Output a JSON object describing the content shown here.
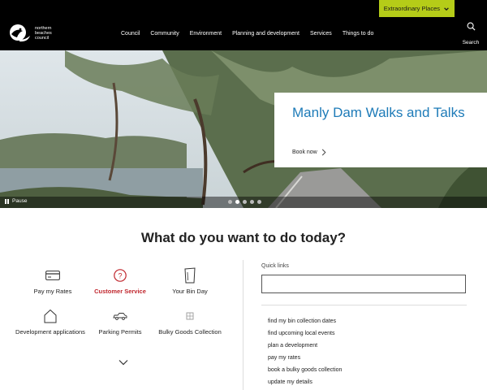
{
  "utility": {
    "extraordinary_label": "Extraordinary Places",
    "accent": "#b5cc18"
  },
  "header": {
    "logo_lines": [
      "northern",
      "beaches",
      "council"
    ],
    "nav": [
      "Council",
      "Community",
      "Environment",
      "Planning and development",
      "Services",
      "Things to do"
    ],
    "search_label": "Search"
  },
  "hero": {
    "title": "Manly Dam Walks and Talks",
    "link_label": "Book now",
    "pause_label": "Pause",
    "slides": 5,
    "active_slide": 2,
    "title_color": "#1e7bb8"
  },
  "main": {
    "question": "What do you want to do today?",
    "tasks": [
      {
        "label": "Pay my Rates",
        "icon": "credit-card-icon"
      },
      {
        "label": "Customer Service",
        "icon": "question-mark-icon",
        "color": "#c0262d"
      },
      {
        "label": "Your Bin Day",
        "icon": "bin-icon"
      },
      {
        "label": "Development applications",
        "icon": "house-icon"
      },
      {
        "label": "Parking Permits",
        "icon": "car-icon"
      },
      {
        "label": "Bulky Goods Collection",
        "icon": "bulky-goods-icon"
      }
    ],
    "quick_links_label": "Quick links",
    "quick_links": [
      "find my bin collection dates",
      "find upcoming local events",
      "plan a development",
      "pay my rates",
      "book a bulky goods collection",
      "update my details"
    ]
  }
}
